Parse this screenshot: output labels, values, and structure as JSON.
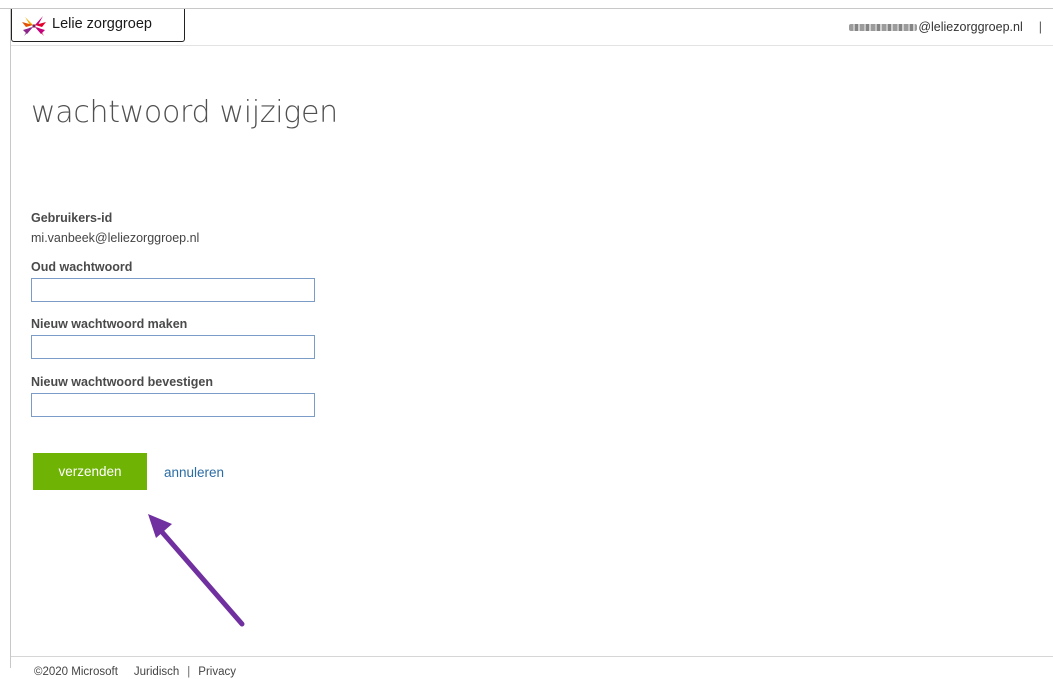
{
  "header": {
    "logo_text": "Lelie zorggroep",
    "user_email_domain": "@leliezorggroep.nl",
    "separator": "|"
  },
  "page": {
    "title": "wachtwoord wijzigen"
  },
  "form": {
    "user_id_label": "Gebruikers-id",
    "user_id_value": "mi.vanbeek@leliezorggroep.nl",
    "old_password_label": "Oud wachtwoord",
    "old_password_value": "",
    "new_password_label": "Nieuw wachtwoord maken",
    "new_password_value": "",
    "confirm_password_label": "Nieuw wachtwoord bevestigen",
    "confirm_password_value": "",
    "submit_label": "verzenden",
    "cancel_label": "annuleren"
  },
  "annotation": {
    "arrow_color": "#7030a0",
    "arrow_icon": "arrow-pointer-icon"
  },
  "colors": {
    "primary_button": "#6fb304",
    "link": "#2b6ca3",
    "input_border": "#7a9cc7"
  },
  "footer": {
    "copyright": "©2020 Microsoft",
    "legal_link": "Juridisch",
    "separator": "|",
    "privacy_link": "Privacy"
  }
}
